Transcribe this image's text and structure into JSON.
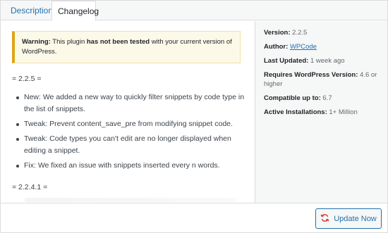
{
  "tabs": [
    {
      "label": "Description"
    },
    {
      "label": "Changelog"
    }
  ],
  "notice": {
    "warning_label": "Warning:",
    "text_pre": "This plugin ",
    "text_bold": "has not been tested",
    "text_post": " with your current version of WordPress."
  },
  "changelog": {
    "versions": [
      {
        "heading": "= 2.2.5 =",
        "items": [
          "New: We added a new way to quickly filter snippets by code type in the list of snippets.",
          "Tweak: Prevent content_save_pre from modifying snippet code.",
          "Tweak: Code types you can't edit are no longer displayed when editing a snippet.",
          "Fix: We fixed an issue with snippets inserted every n words."
        ]
      },
      {
        "heading": "= 2.2.4.1 =",
        "items": []
      }
    ]
  },
  "sidebar": {
    "version_label": "Version:",
    "version_value": "2.2.5",
    "author_label": "Author:",
    "author_value": "WPCode",
    "last_updated_label": "Last Updated:",
    "last_updated_value": "1 week ago",
    "requires_label": "Requires WordPress Version:",
    "requires_value": "4.6 or higher",
    "compatible_label": "Compatible up to:",
    "compatible_value": "6.7",
    "installs_label": "Active Installations:",
    "installs_value": "1+ Million"
  },
  "footer": {
    "update_label": "Update Now",
    "update_icon": "refresh-icon",
    "accent_color": "#2271b1",
    "icon_color": "#d63638"
  }
}
